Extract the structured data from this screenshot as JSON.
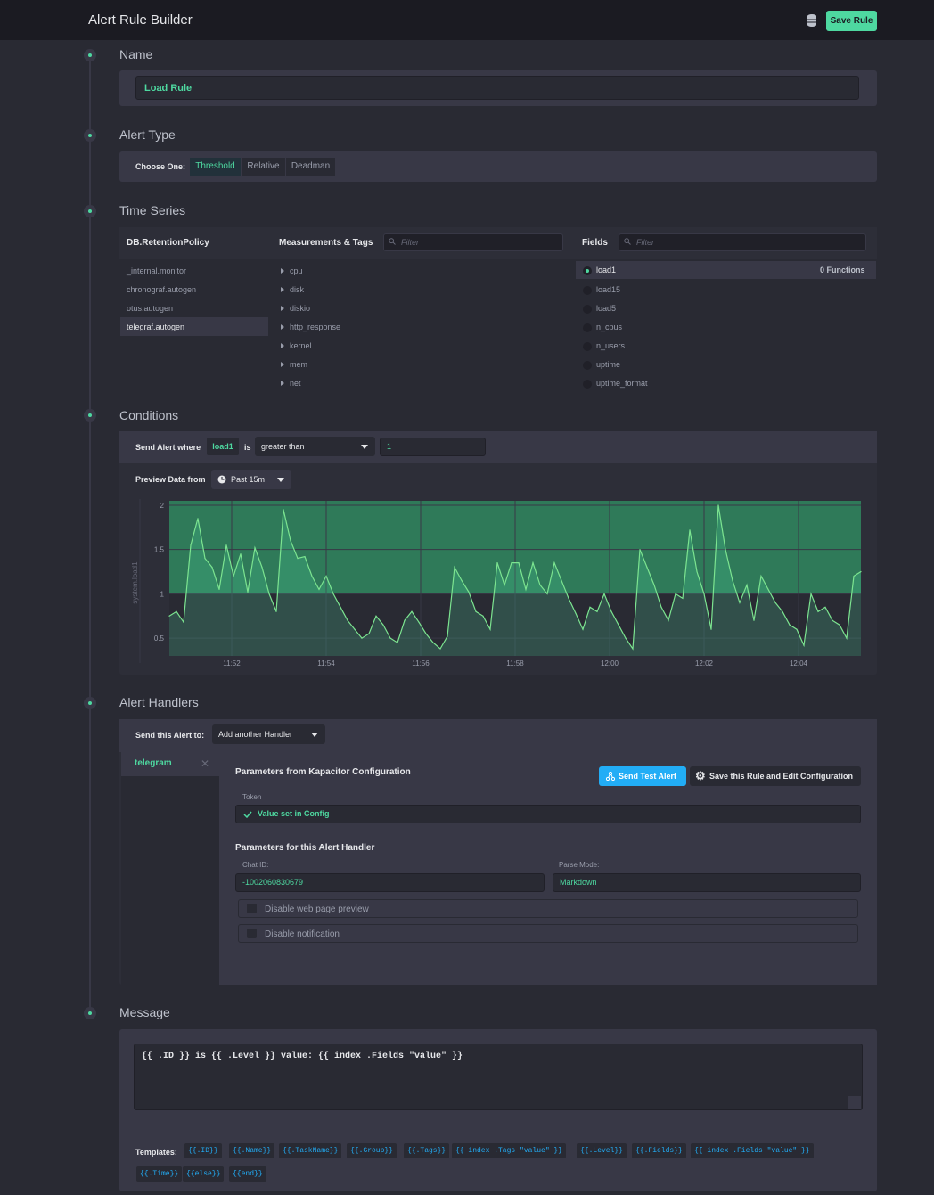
{
  "header": {
    "title": "Alert Rule Builder",
    "save_label": "Save Rule"
  },
  "sections": {
    "name": "Name",
    "alert_type": "Alert Type",
    "time_series": "Time Series",
    "conditions": "Conditions",
    "alert_handlers": "Alert Handlers",
    "message": "Message"
  },
  "name_input": {
    "value": "Load Rule"
  },
  "alert_type": {
    "choose_label": "Choose One:",
    "options": [
      "Threshold",
      "Relative",
      "Deadman"
    ],
    "selected": "Threshold"
  },
  "time_series": {
    "db_header": "DB.RetentionPolicy",
    "db_items": [
      "_internal.monitor",
      "chronograf.autogen",
      "otus.autogen",
      "telegraf.autogen"
    ],
    "db_selected": "telegraf.autogen",
    "meas_header": "Measurements & Tags",
    "meas_filter_placeholder": "Filter",
    "meas_items": [
      "cpu",
      "disk",
      "diskio",
      "http_response",
      "kernel",
      "mem",
      "net"
    ],
    "fields_header": "Fields",
    "fields_filter_placeholder": "Filter",
    "fields_items": [
      "load1",
      "load15",
      "load5",
      "n_cpus",
      "n_users",
      "uptime",
      "uptime_format"
    ],
    "field_selected": "load1",
    "functions_label": "0 Functions"
  },
  "conditions": {
    "send_label": "Send Alert where",
    "field": "load1",
    "is_label": "is",
    "operator": "greater than",
    "value": "1",
    "preview_label": "Preview Data from",
    "preview_range": "Past 15m"
  },
  "chart_data": {
    "type": "area",
    "ylabel": "system.load1",
    "ylim": [
      0.3,
      2.05
    ],
    "yticks": [
      0.5,
      1,
      1.5,
      2
    ],
    "ytick_labels": [
      "0.5",
      "1.5",
      "1",
      "2"
    ],
    "xticks": [
      "11:52",
      "11:54",
      "11:56",
      "11:58",
      "12:00",
      "12:02",
      "12:04"
    ],
    "threshold": 1,
    "colors": {
      "line": "#7ce490",
      "fill": "#4ed8a0"
    },
    "series": [
      {
        "values": [
          0.75,
          0.8,
          0.68,
          1.55,
          1.85,
          1.4,
          1.3,
          1.05,
          1.55,
          1.2,
          1.45,
          1.02,
          1.52,
          1.3,
          1.0,
          0.8,
          1.95,
          1.6,
          1.4,
          1.42,
          1.2,
          1.05,
          1.2,
          1.0,
          0.85,
          0.7,
          0.6,
          0.5,
          0.55,
          0.75,
          0.65,
          0.5,
          0.45,
          0.7,
          0.8,
          0.68,
          0.55,
          0.45,
          0.38,
          0.52,
          1.3,
          1.15,
          1.02,
          0.8,
          0.75,
          0.6,
          1.35,
          1.1,
          1.35,
          1.35,
          1.05,
          1.35,
          1.1,
          1.0,
          1.35,
          1.15,
          0.95,
          0.78,
          0.6,
          0.85,
          0.8,
          1.0,
          0.8,
          0.65,
          0.5,
          0.38,
          1.5,
          1.3,
          1.1,
          0.85,
          0.7,
          1.0,
          0.95,
          1.72,
          1.25,
          1.0,
          0.6,
          2.0,
          1.5,
          1.15,
          0.9,
          1.1,
          0.7,
          1.2,
          1.05,
          0.9,
          0.8,
          0.65,
          0.6,
          0.42,
          1.0,
          0.8,
          0.85,
          0.7,
          0.65,
          0.5,
          1.2,
          1.25
        ]
      }
    ]
  },
  "handlers": {
    "send_label": "Send this Alert to:",
    "add_handler": "Add another Handler",
    "tab": "telegram",
    "params_kapacitor": "Parameters from Kapacitor Configuration",
    "test_button": "Send Test Alert",
    "edit_button": "Save this Rule and Edit Configuration",
    "token_label": "Token",
    "token_value": "Value set in Config",
    "params_handler": "Parameters for this Alert Handler",
    "chat_id_label": "Chat ID:",
    "chat_id_value": "-1002060830679",
    "parse_mode_label": "Parse Mode:",
    "parse_mode_value": "Markdown",
    "checkbox1": "Disable web page preview",
    "checkbox2": "Disable notification"
  },
  "message": {
    "text": "{{ .ID }} is {{ .Level }} value: {{ index .Fields \"value\" }}",
    "templates_label": "Templates:",
    "templates": [
      "{{.ID}}",
      "{{.Name}}",
      "{{.TaskName}}",
      "{{.Group}}",
      "{{.Tags}}",
      "{{ index .Tags \"value\" }}",
      "{{.Level}}",
      "{{.Fields}}",
      "{{ index .Fields \"value\" }}",
      "{{.Time}}",
      "{{else}}",
      "{{end}}"
    ]
  }
}
